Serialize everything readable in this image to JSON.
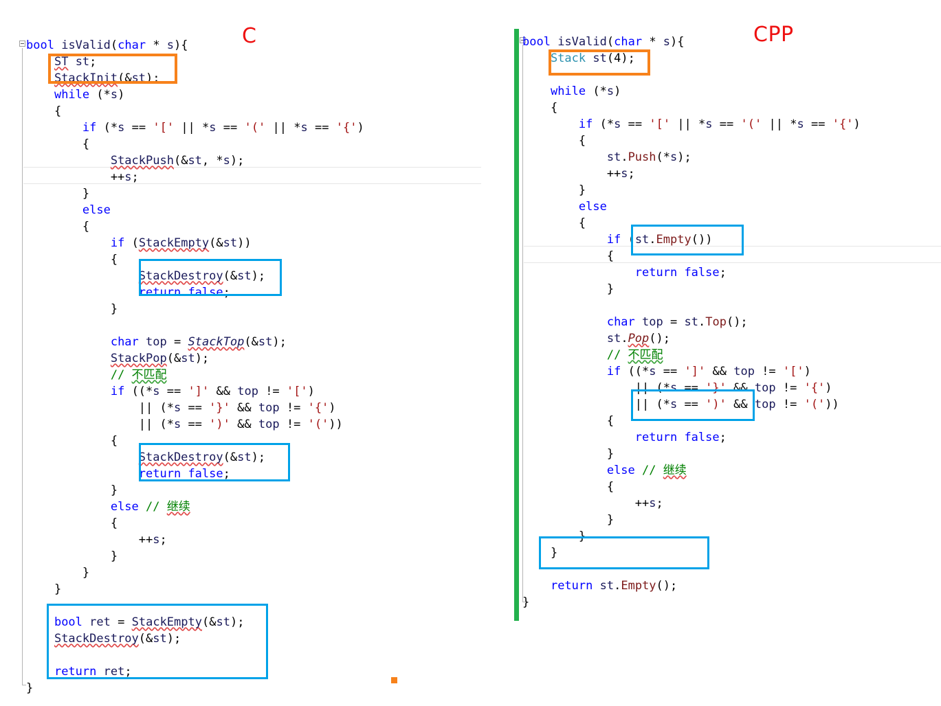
{
  "page": {
    "title": "C vs CPP isValid bracket-matching code comparison",
    "background": "#ffffff"
  },
  "colors": {
    "keyword": "#0000ff",
    "identifier": "#1a1a5a",
    "char_literal": "#a31515",
    "class_type": "#2b91af",
    "member_fn": "#7c1919",
    "comment": "#008000",
    "anno_blue": "#00a2e8",
    "anno_orange": "#f7821b",
    "change_bar_green": "#23b14d",
    "label_red": "#ee1111"
  },
  "labels": {
    "c": "C",
    "cpp": "CPP"
  },
  "panels": {
    "c": {
      "name": "C",
      "lines": [
        "bool isValid(char * s){",
        "    ST st;",
        "    StackInit(&st);",
        "    while (*s)",
        "    {",
        "        if (*s == '[' || *s == '(' || *s == '{')",
        "        {",
        "            StackPush(&st, *s);",
        "            ++s;",
        "        }",
        "        else",
        "        {",
        "            if (StackEmpty(&st))",
        "            {",
        "                StackDestroy(&st);",
        "                return false;",
        "            }",
        "",
        "            char top = StackTop(&st);",
        "            StackPop(&st);",
        "            // 不匹配",
        "            if ((*s == ']' && top != '[')",
        "                || (*s == '}' && top != '{')",
        "                || (*s == ')' && top != '('))",
        "            {",
        "                StackDestroy(&st);",
        "                return false;",
        "            }",
        "            else // 继续",
        "            {",
        "                ++s;",
        "            }",
        "        }",
        "    }",
        "",
        "    bool ret = StackEmpty(&st);",
        "    StackDestroy(&st);",
        "",
        "    return ret;",
        "}"
      ],
      "current_line_text": "++s;",
      "annotations": [
        {
          "type": "orange-box",
          "label": "stack-init-box",
          "contents": [
            "ST st;",
            "StackInit(&st);"
          ]
        },
        {
          "type": "blue-box",
          "label": "destroy-return-false-box-1",
          "contents": [
            "StackDestroy(&st);",
            "return false;"
          ]
        },
        {
          "type": "blue-box",
          "label": "destroy-return-false-box-2",
          "contents": [
            "StackDestroy(&st);",
            "return false;"
          ]
        },
        {
          "type": "blue-box",
          "label": "cleanup-return-box",
          "contents": [
            "bool ret = StackEmpty(&st);",
            "StackDestroy(&st);",
            "",
            "return ret;"
          ]
        }
      ]
    },
    "cpp": {
      "name": "CPP",
      "lines": [
        "bool isValid(char * s){",
        "    Stack st(4);",
        "",
        "    while (*s)",
        "    {",
        "        if (*s == '[' || *s == '(' || *s == '{')",
        "        {",
        "            st.Push(*s);",
        "            ++s;",
        "        }",
        "        else",
        "        {",
        "            if (st.Empty())",
        "            {",
        "                return false;",
        "            }",
        "",
        "            char top = st.Top();",
        "            st.Pop();",
        "            // 不匹配",
        "            if ((*s == ']' && top != '[')",
        "                || (*s == '}' && top != '{')",
        "                || (*s == ')' && top != '('))",
        "            {",
        "                return false;",
        "            }",
        "            else // 继续",
        "            {",
        "                ++s;",
        "            }",
        "        }",
        "    }",
        "",
        "    return st.Empty();",
        "}"
      ],
      "current_line_text": "{",
      "annotations": [
        {
          "type": "orange-box",
          "label": "stack-construct-box",
          "contents": [
            "Stack st(4);"
          ]
        },
        {
          "type": "blue-box",
          "label": "return-false-box-1",
          "contents": [
            "return false;"
          ]
        },
        {
          "type": "blue-box",
          "label": "return-false-box-2",
          "contents": [
            "return false;"
          ]
        },
        {
          "type": "blue-box",
          "label": "return-empty-box",
          "contents": [
            "return st.Empty();"
          ]
        }
      ]
    }
  },
  "comments": {
    "mismatch": "不匹配",
    "continue": "继续"
  }
}
